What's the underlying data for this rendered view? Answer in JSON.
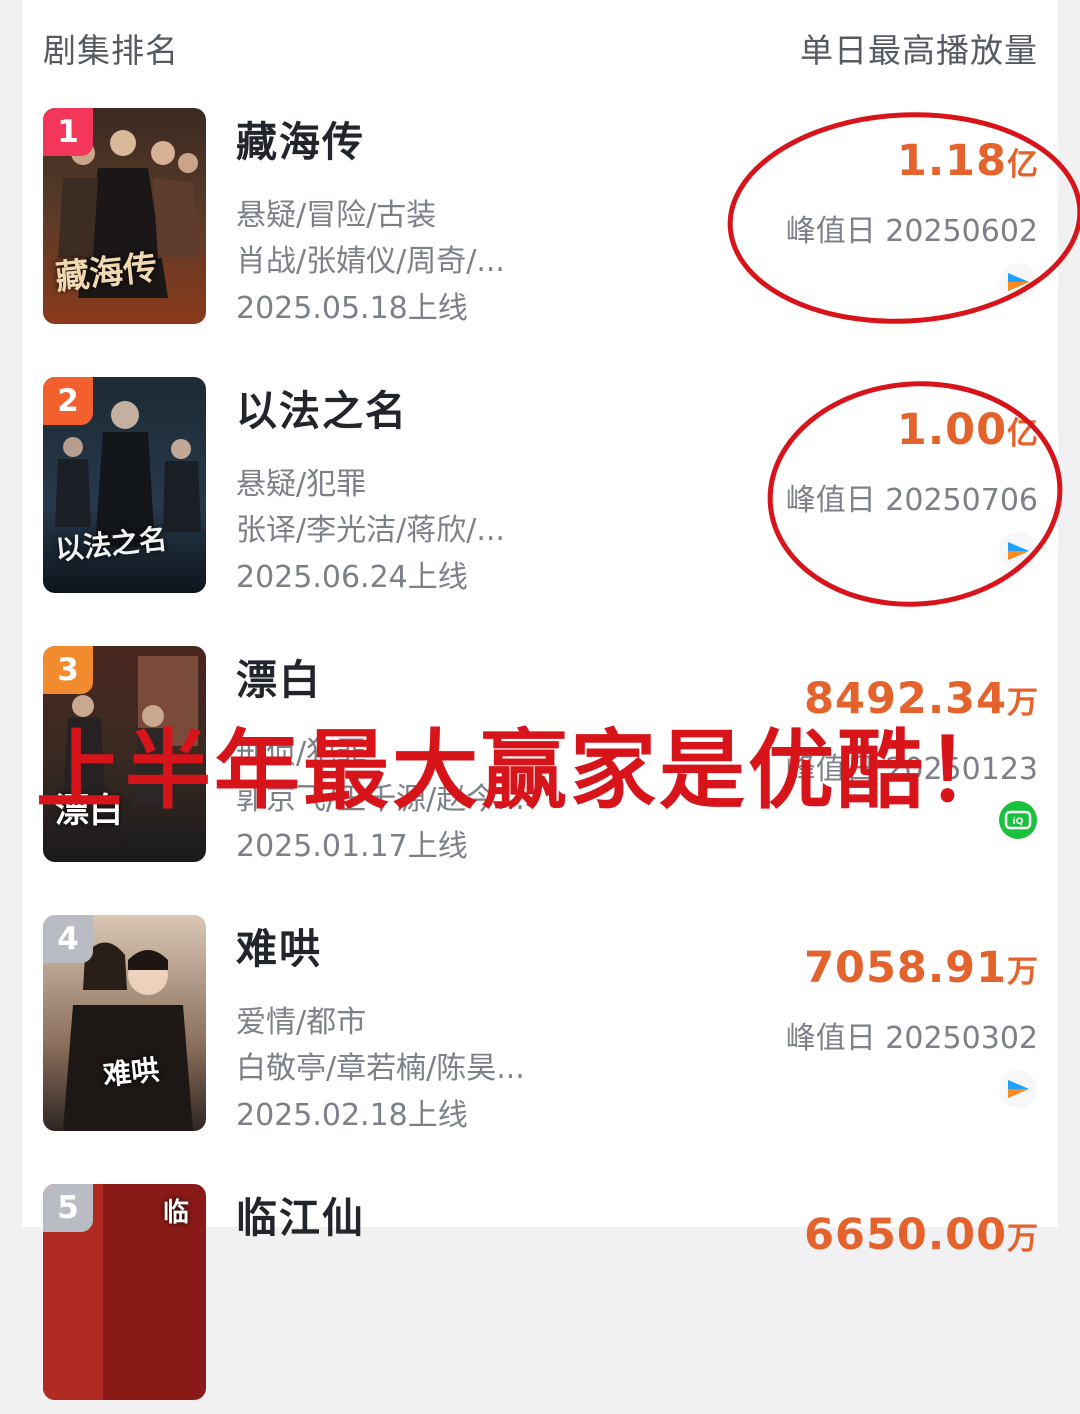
{
  "header": {
    "left_label": "剧集排名",
    "right_label": "单日最高播放量"
  },
  "rows": [
    {
      "rank": "1",
      "rank_color": "#f4365a",
      "title": "藏海传",
      "poster_text": "藏海传",
      "genre": "悬疑/冒险/古装",
      "cast": "肖战/张婧仪/周奇/...",
      "date": "2025.05.18上线",
      "value": "1.18",
      "unit": "亿",
      "peak": "峰值日 20250602",
      "platform": "youku-icon"
    },
    {
      "rank": "2",
      "rank_color": "#f2602e",
      "title": "以法之名",
      "poster_text": "以法之名",
      "genre": "悬疑/犯罪",
      "cast": "张译/李光洁/蒋欣/...",
      "date": "2025.06.24上线",
      "value": "1.00",
      "unit": "亿",
      "peak": "峰值日 20250706",
      "platform": "youku-icon"
    },
    {
      "rank": "3",
      "rank_color": "#f28a2e",
      "title": "漂白",
      "poster_text": "漂白",
      "genre": "刑侦/犯罪",
      "cast": "郭京飞/王千源/赵今...",
      "date": "2025.01.17上线",
      "value": "8492.34",
      "unit": "万",
      "peak": "峰值日 20250123",
      "platform": "iqiyi-icon"
    },
    {
      "rank": "4",
      "rank_color": "#b9bcc2",
      "title": "难哄",
      "poster_text": "难哄",
      "genre": "爱情/都市",
      "cast": "白敬亭/章若楠/陈昊...",
      "date": "2025.02.18上线",
      "value": "7058.91",
      "unit": "万",
      "peak": "峰值日 20250302",
      "platform": "youku-icon"
    },
    {
      "rank": "5",
      "rank_color": "#b9bcc2",
      "title": "临江仙",
      "poster_text": "临",
      "genre": "",
      "cast": "",
      "date": "",
      "value": "6650.00",
      "unit": "万",
      "peak": "",
      "platform": ""
    }
  ],
  "overlay": {
    "text": "上半年最大赢家是优酷！",
    "color": "#d8141b"
  },
  "colors": {
    "accent": "#e4622b",
    "annotation": "#d8141b"
  }
}
